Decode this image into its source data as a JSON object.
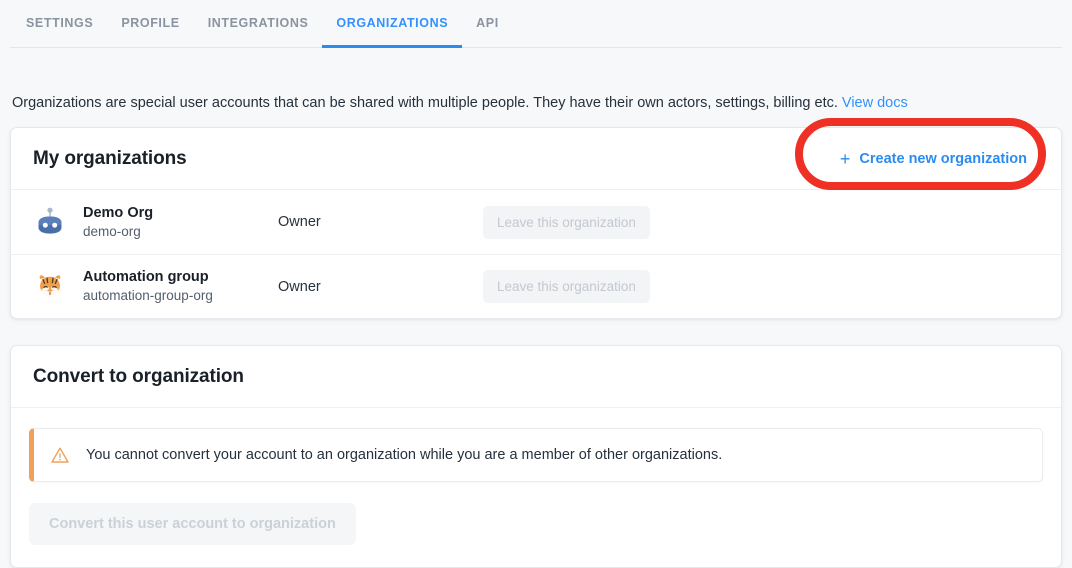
{
  "tabs": [
    {
      "label": "SETTINGS",
      "active": false
    },
    {
      "label": "PROFILE",
      "active": false
    },
    {
      "label": "INTEGRATIONS",
      "active": false
    },
    {
      "label": "ORGANIZATIONS",
      "active": true
    },
    {
      "label": "API",
      "active": false
    }
  ],
  "intro": {
    "text": "Organizations are special user accounts that can be shared with multiple people. They have their own actors, settings, billing etc.",
    "link_label": "View docs"
  },
  "my_organizations": {
    "title": "My organizations",
    "create_button_label": "Create new organization",
    "create_button_icon": "plus-icon",
    "highlight_color": "#ee3124",
    "rows": [
      {
        "avatar": "robot-avatar-icon",
        "name": "Demo Org",
        "slug": "demo-org",
        "role": "Owner",
        "action_label": "Leave this organization",
        "action_disabled": true
      },
      {
        "avatar": "tiger-avatar-icon",
        "name": "Automation group",
        "slug": "automation-group-org",
        "role": "Owner",
        "action_label": "Leave this organization",
        "action_disabled": true
      }
    ]
  },
  "convert": {
    "title": "Convert to organization",
    "alert_icon": "warning-triangle-icon",
    "alert_text": "You cannot convert your account to an organization while you are a member of other organizations.",
    "alert_accent_color": "#f0a05a",
    "button_label": "Convert this user account to organization",
    "button_disabled": true
  },
  "colors": {
    "accent_blue": "#2b8cf0",
    "page_background": "#f7f8f9",
    "warning_orange": "#f0a05a",
    "highlight_red": "#ee3124"
  }
}
